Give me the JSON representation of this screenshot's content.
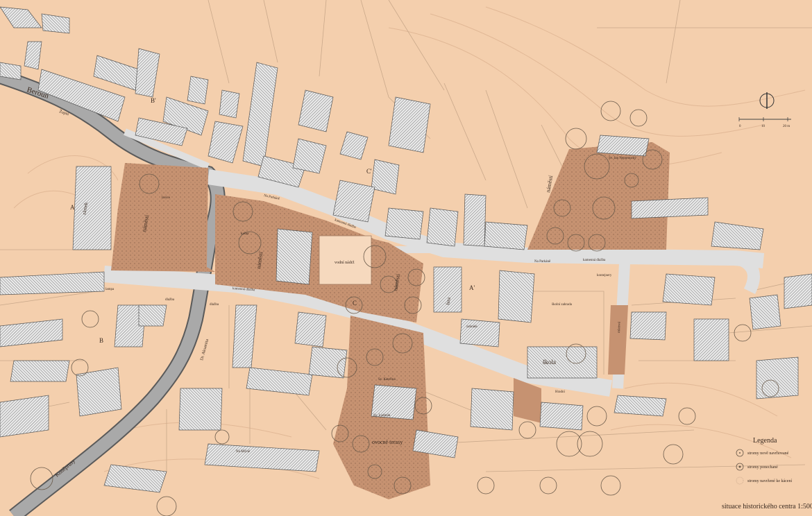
{
  "colors": {
    "background": "#f4cfad",
    "plot_line": "#c9a88a",
    "contour": "#e1b896",
    "square": "#c69271",
    "square_dark": "#b07e5e",
    "road": "#a9a9a9",
    "road_edge": "#5a5a5a",
    "street": "#dfdfdf",
    "building": "#e6e6e6",
    "building_edge": "#555555",
    "tree": "#6a5a4a"
  },
  "streets": {
    "beroun": "Beroun",
    "zupni": "Župní",
    "na_parkane_1": "Na Parkáně",
    "na_parkane_2": "Na Parkáně",
    "kamenna_dlazba_1": "kamenná dlažba",
    "kamenna_dlazba_2": "kamenná dlažba",
    "kamenna_dlazba_3": "kamenná dlažba",
    "dlazba_1": "dlažba",
    "dlazba_2": "dlažba",
    "dr_aksamita": "Dr. Aksamita",
    "koneprusy": "Koněprusy",
    "hradni": "Hradní",
    "na_mlyne": "Na Mlýně",
    "mlatova": "mlatová"
  },
  "places": {
    "zamek": "zámek",
    "namesti_1": "náměstí",
    "namesti_2": "náměstí",
    "namesti_3": "náměstí",
    "namesti_4": "náměstí",
    "lavice": "lavice",
    "kasna": "kašna",
    "vodni_nadrz": "vodní nádrž",
    "fara": "fara",
    "skola": "škola",
    "skolni_zahrada": "školní zahrada",
    "kontejnery": "kontejnery",
    "sv_jan": "Sv. Jan Nepomucký",
    "sv_katerina": "Sv. Kateřina",
    "sv_ludmila": "Sv. Ludmila",
    "ovocne_terasy": "ovocné terasy",
    "lampa": "lampa",
    "zahrada": "zahrada"
  },
  "sections": {
    "A": "A",
    "A2": "A'",
    "B": "B",
    "B2": "B'",
    "C": "C",
    "C2": "C'"
  },
  "scale": {
    "t0": "0",
    "t10": "10",
    "t20": "20 m"
  },
  "legend": {
    "title": "Legenda",
    "items": [
      "stromy nově navrhované",
      "stromy ponechané",
      "stromy navržené ke kácení"
    ]
  },
  "caption": "situace historického centra 1:500"
}
